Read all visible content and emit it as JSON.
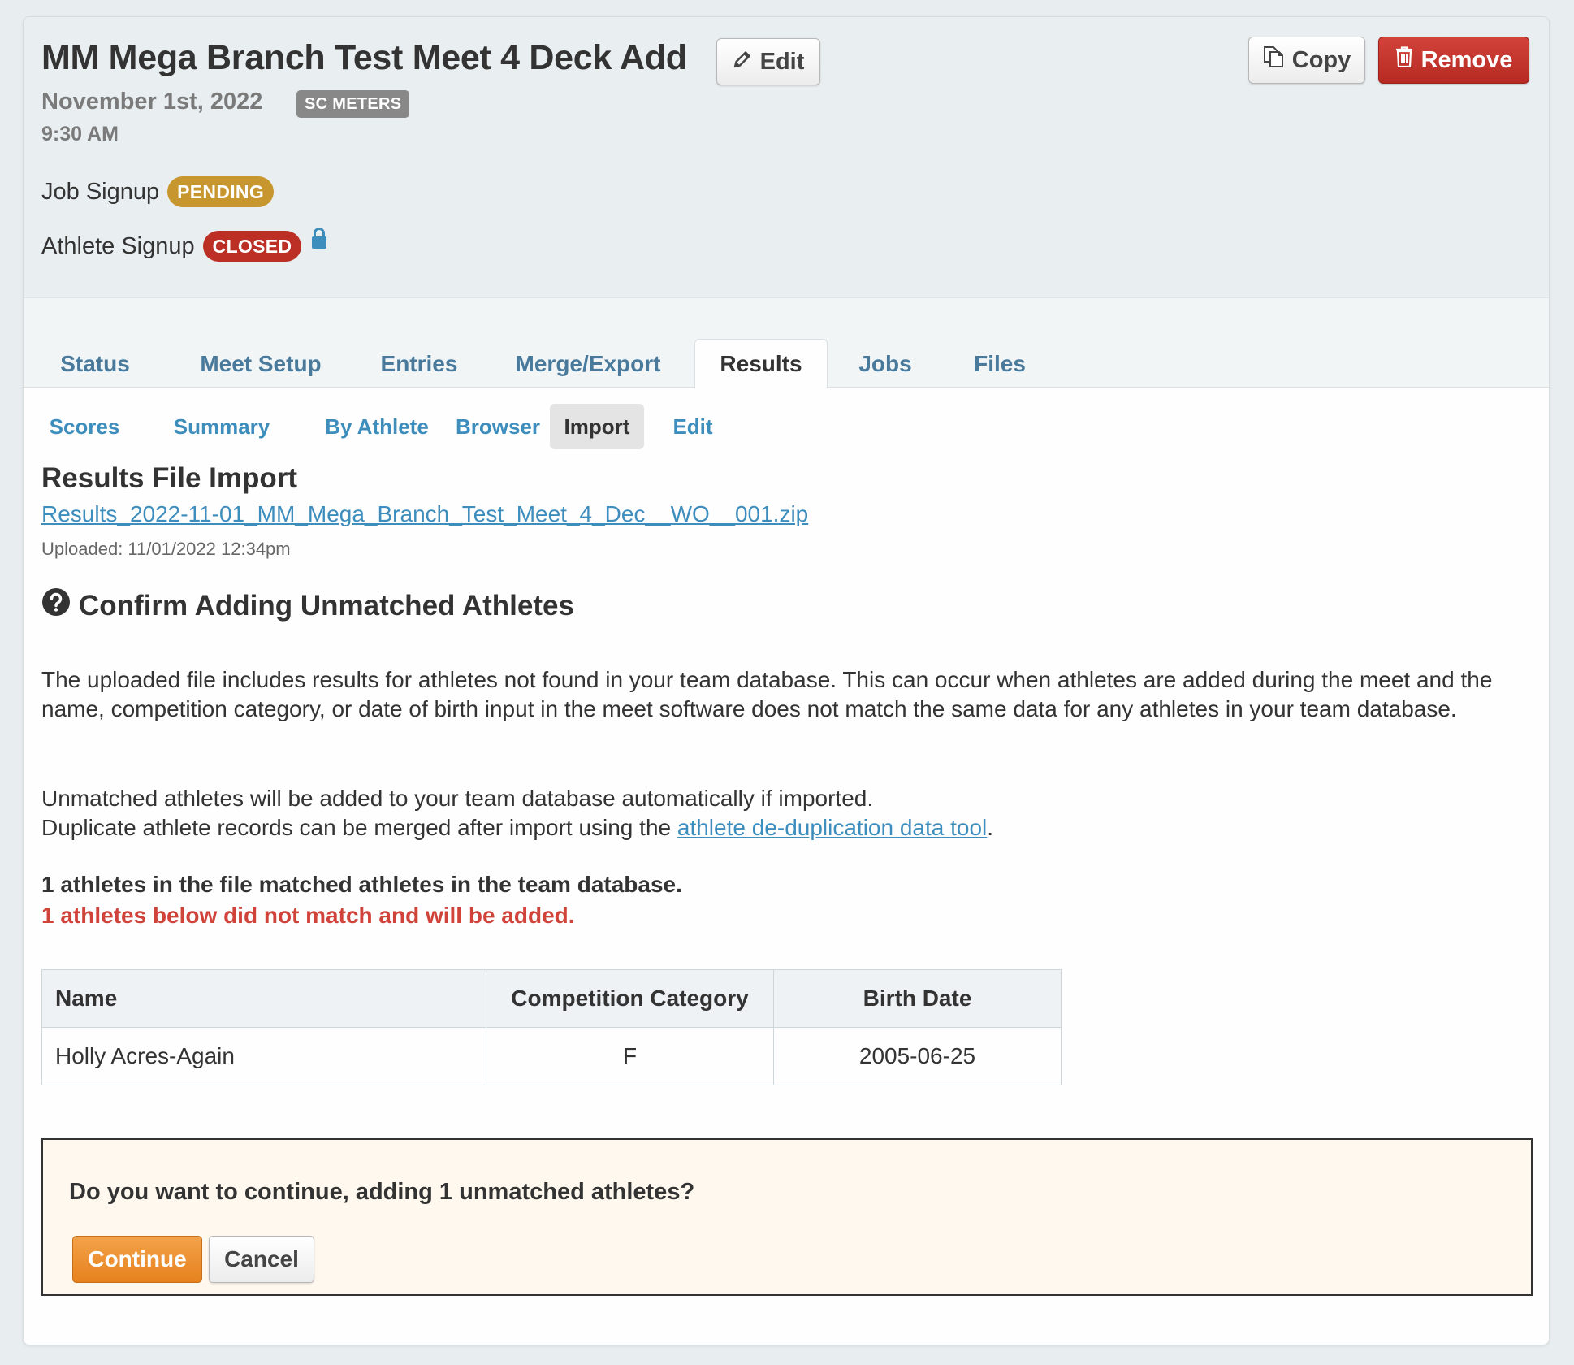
{
  "meet": {
    "title": "MM Mega Branch Test Meet 4 Deck Add",
    "date": "November 1st, 2022",
    "course": "SC METERS",
    "time": "9:30 AM"
  },
  "actions": {
    "edit_label": "Edit",
    "copy_label": "Copy",
    "remove_label": "Remove"
  },
  "signups": {
    "job_label": "Job Signup",
    "job_status": "PENDING",
    "athlete_label": "Athlete Signup",
    "athlete_status": "CLOSED"
  },
  "tabs": [
    {
      "label": "Status"
    },
    {
      "label": "Meet Setup"
    },
    {
      "label": "Entries"
    },
    {
      "label": "Merge/Export"
    },
    {
      "label": "Results",
      "active": true
    },
    {
      "label": "Jobs"
    },
    {
      "label": "Files"
    }
  ],
  "subtabs": [
    {
      "label": "Scores"
    },
    {
      "label": "Summary"
    },
    {
      "label": "By Athlete"
    },
    {
      "label": "Browser"
    },
    {
      "label": "Import",
      "active": true
    },
    {
      "label": "Edit"
    }
  ],
  "import": {
    "title": "Results File Import",
    "file_name": "Results_2022-11-01_MM_Mega_Branch_Test_Meet_4_Dec__WO__001.zip",
    "uploaded": "Uploaded: 11/01/2022 12:34pm"
  },
  "confirm": {
    "heading": "Confirm Adding Unmatched Athletes",
    "paragraph1": "The uploaded file includes results for athletes not found in your team database. This can occur when athletes are added during the meet and the name, competition category, or date of birth input in the meet software does not match the same data for any athletes in your team database.",
    "paragraph2_line1": "Unmatched athletes will be added to your team database automatically if imported.",
    "paragraph2_line2_prefix": "Duplicate athlete records can be merged after import using the ",
    "dedup_link": "athlete de-duplication data tool",
    "paragraph2_line2_suffix": ".",
    "matched_text": "1 athletes in the file matched athletes in the team database.",
    "unmatched_text": "1 athletes below did not match and will be added."
  },
  "table": {
    "headers": {
      "name": "Name",
      "category": "Competition Category",
      "birth": "Birth Date"
    },
    "rows": [
      {
        "name": "Holly Acres-Again",
        "category": "F",
        "birth": "2005-06-25"
      }
    ]
  },
  "continue_box": {
    "question": "Do you want to continue, adding 1 unmatched athletes?",
    "continue_label": "Continue",
    "cancel_label": "Cancel"
  },
  "colors": {
    "link": "#3d8dbd",
    "pending": "#c8962e",
    "closed": "#bb2f24",
    "remove": "#c0362d",
    "continue": "#ec8f2f",
    "unmatched_text": "#d0433a"
  },
  "icons": {
    "edit": "pencil-icon",
    "copy": "copy-icon",
    "remove": "trash-icon",
    "lock": "lock-icon",
    "question": "question-circle-icon"
  }
}
